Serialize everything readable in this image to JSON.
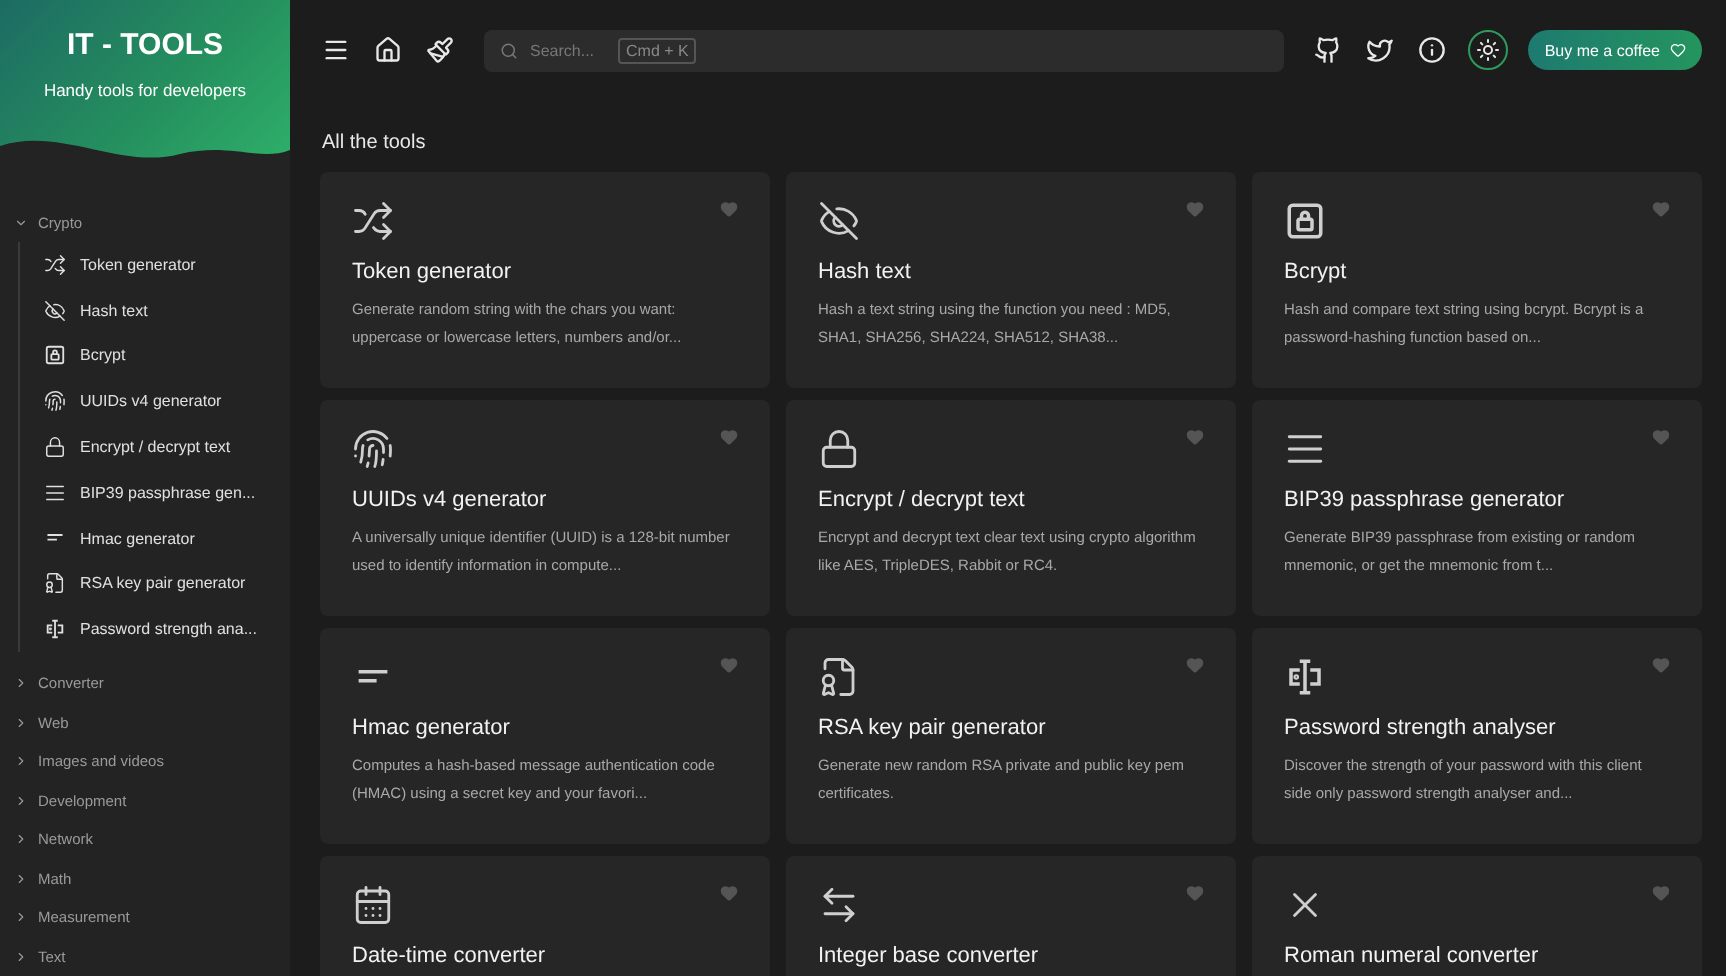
{
  "sidebar": {
    "title": "IT - TOOLS",
    "subtitle": "Handy tools for developers",
    "categories": [
      {
        "name": "Crypto",
        "expanded": true,
        "items": [
          "Token generator",
          "Hash text",
          "Bcrypt",
          "UUIDs v4 generator",
          "Encrypt / decrypt text",
          "BIP39 passphrase gen...",
          "Hmac generator",
          "RSA key pair generator",
          "Password strength ana..."
        ]
      },
      {
        "name": "Converter",
        "expanded": false
      },
      {
        "name": "Web",
        "expanded": false
      },
      {
        "name": "Images and videos",
        "expanded": false
      },
      {
        "name": "Development",
        "expanded": false
      },
      {
        "name": "Network",
        "expanded": false
      },
      {
        "name": "Math",
        "expanded": false
      },
      {
        "name": "Measurement",
        "expanded": false
      },
      {
        "name": "Text",
        "expanded": false
      }
    ]
  },
  "header": {
    "search": {
      "placeholder": "Search...",
      "shortcut": "Cmd + K"
    },
    "coffee_button": "Buy me a coffee"
  },
  "section_title": "All the tools",
  "tools": [
    {
      "title": "Token generator",
      "description": "Generate random string with the chars you want: uppercase or lowercase letters, numbers and/or..."
    },
    {
      "title": "Hash text",
      "description": "Hash a text string using the function you need : MD5, SHA1, SHA256, SHA224, SHA512, SHA38..."
    },
    {
      "title": "Bcrypt",
      "description": "Hash and compare text string using bcrypt. Bcrypt is a password-hashing function based on..."
    },
    {
      "title": "UUIDs v4 generator",
      "description": "A universally unique identifier (UUID) is a 128-bit number used to identify information in compute..."
    },
    {
      "title": "Encrypt / decrypt text",
      "description": "Encrypt and decrypt text clear text using crypto algorithm like AES, TripleDES, Rabbit or RC4."
    },
    {
      "title": "BIP39 passphrase generator",
      "description": "Generate BIP39 passphrase from existing or random mnemonic, or get the mnemonic from t..."
    },
    {
      "title": "Hmac generator",
      "description": "Computes a hash-based message authentication code (HMAC) using a secret key and your favori..."
    },
    {
      "title": "RSA key pair generator",
      "description": "Generate new random RSA private and public key pem certificates."
    },
    {
      "title": "Password strength analyser",
      "description": "Discover the strength of your password with this client side only password strength analyser and..."
    },
    {
      "title": "Date-time converter"
    },
    {
      "title": "Integer base converter"
    },
    {
      "title": "Roman numeral converter"
    }
  ]
}
